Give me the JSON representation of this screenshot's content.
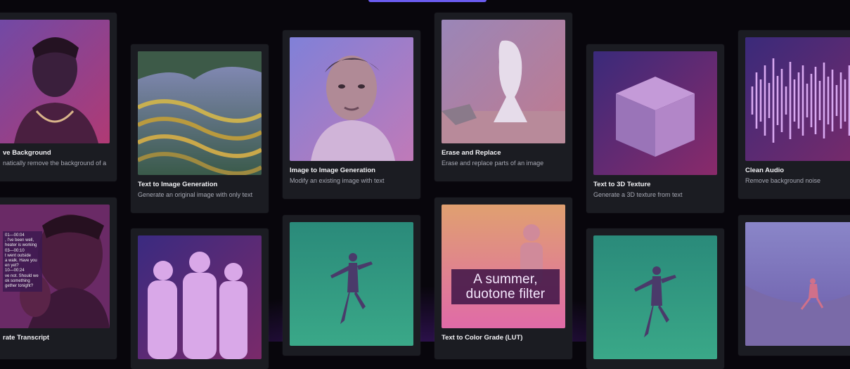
{
  "cards": {
    "remove_bg": {
      "title": "ve Background",
      "desc": "natically remove the background of a"
    },
    "text_to_image": {
      "title": "Text to Image Generation",
      "desc": "Generate an original image with only text"
    },
    "image_to_image": {
      "title": "Image to Image Generation",
      "desc": "Modify an existing image with text"
    },
    "erase_replace": {
      "title": "Erase and Replace",
      "desc": "Erase and replace parts of an image"
    },
    "text_to_3d": {
      "title": "Text to 3D Texture",
      "desc": "Generate a 3D texture from text"
    },
    "clean_audio": {
      "title": "Clean Audio",
      "desc": "Remove background noise"
    },
    "transcript": {
      "title": "rate Transcript",
      "overlay": "01—00:04\n, I've been well,\nheater is working\n03—00:10\nt went outside\na walk. Have you\nen yet?\n10—00:24\nve not. Should we\nok something\ngether tonight?"
    },
    "color_grade": {
      "title": "Text to Color Grade (LUT)",
      "overlay": "A summer, duotone filter"
    }
  }
}
